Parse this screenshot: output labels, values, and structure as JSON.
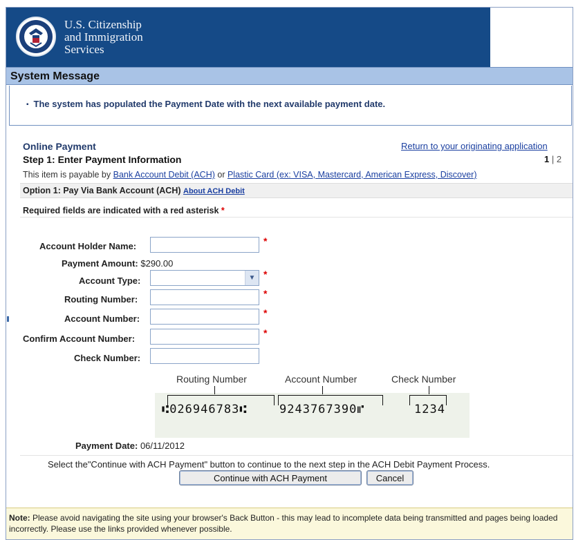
{
  "header": {
    "agency_line1": "U.S. Citizenship",
    "agency_line2": "and Immigration",
    "agency_line3": "Services",
    "seal_icon": "dhs-seal-icon"
  },
  "system_message": {
    "title": "System Message",
    "text": "The system has populated the Payment Date with the next available payment date."
  },
  "payment": {
    "section_title": "Online Payment",
    "return_link": "Return to your originating application",
    "step_title": "Step 1: Enter Payment Information",
    "step_current": "1",
    "step_separator": " | ",
    "step_next": "2",
    "payable_prefix": "This item is payable by ",
    "payable_link_ach": "Bank Account Debit (ACH)",
    "payable_or": " or ",
    "payable_link_card": "Plastic Card (ex: VISA, Mastercard, American Express, Discover)",
    "option_title": "Option 1: Pay Via Bank Account (ACH)",
    "option_link": "About ACH Debit",
    "required_note": "Required fields are indicated with a red asterisk",
    "required_star": "*"
  },
  "form": {
    "account_holder_label": "Account Holder Name:",
    "account_holder_value": "",
    "payment_amount_label": "Payment Amount:",
    "payment_amount_value": "$290.00",
    "account_type_label": "Account Type:",
    "account_type_value": "",
    "routing_label": "Routing Number:",
    "routing_value": "",
    "account_number_label": "Account Number:",
    "account_number_value": "",
    "confirm_label": "Confirm Account Number:",
    "confirm_value": "",
    "check_number_label": "Check Number:",
    "check_number_value": "",
    "star": "*"
  },
  "check_diagram": {
    "routing_caption": "Routing Number",
    "account_caption": "Account Number",
    "check_caption": "Check Number",
    "routing_micr": "⑆026946783⑆",
    "account_micr": "9243767390⑈",
    "check_micr": "1234"
  },
  "payment_date": {
    "label": "Payment Date:",
    "value": "06/11/2012"
  },
  "actions": {
    "instruction": "Select the\"Continue with ACH Payment\" button to continue to the next step in the ACH Debit Payment Process.",
    "continue_label": "Continue with ACH Payment",
    "cancel_label": "Cancel"
  },
  "note": {
    "label": "Note:",
    "text": " Please avoid navigating the site using your browser's Back Button - this may lead to incomplete data being transmitted and pages being loaded incorrectly. Please use the links provided whenever possible."
  },
  "colors": {
    "banner": "#154a87",
    "system_bar": "#a9c3e6",
    "link": "#1a3fa0",
    "required": "#dd0000",
    "note_bg": "#fbf8dc"
  }
}
